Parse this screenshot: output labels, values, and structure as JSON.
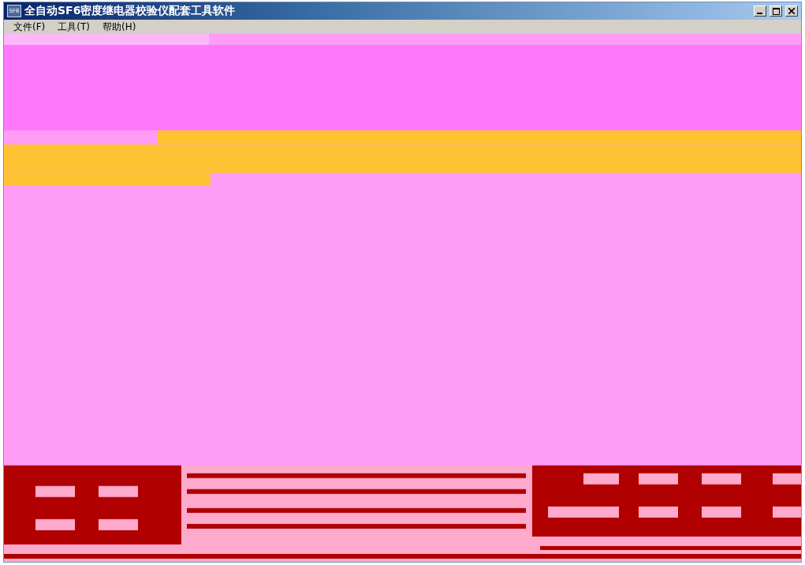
{
  "window": {
    "title": "全自动SF6密度继电器校验仪配套工具软件",
    "icon_text": "SF6"
  },
  "menu": [
    {
      "label": "文件(F)"
    },
    {
      "label": "工具(T)"
    },
    {
      "label": "帮助(H)"
    }
  ]
}
